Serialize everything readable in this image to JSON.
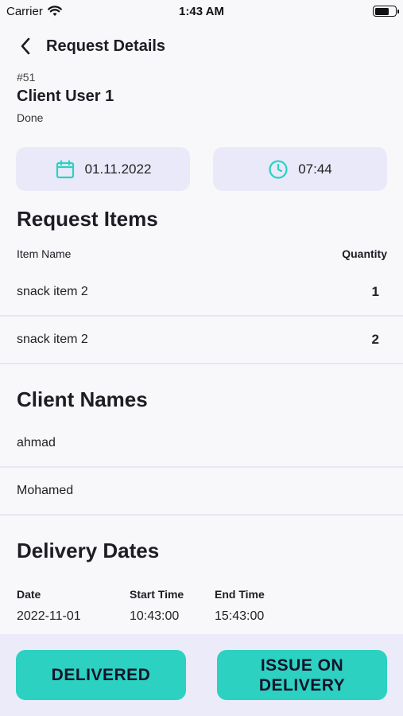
{
  "status_bar": {
    "carrier": "Carrier",
    "time": "1:43 AM"
  },
  "header": {
    "title": "Request Details"
  },
  "request": {
    "id": "#51",
    "client_user": "Client User 1",
    "status": "Done"
  },
  "date_pill": {
    "value": "01.11.2022",
    "icon": "calendar-icon"
  },
  "time_pill": {
    "value": "07:44",
    "icon": "clock-icon"
  },
  "items_section": {
    "title": "Request Items",
    "col_name": "Item Name",
    "col_qty": "Quantity",
    "rows": [
      {
        "name": "snack item 2",
        "qty": "1"
      },
      {
        "name": "snack item 2",
        "qty": "2"
      }
    ]
  },
  "clients_section": {
    "title": "Client Names",
    "names": [
      "ahmad",
      "Mohamed"
    ]
  },
  "delivery_section": {
    "title": "Delivery Dates",
    "col_date": "Date",
    "col_start": "Start Time",
    "col_end": "End Time",
    "rows": [
      {
        "date": "2022-11-01",
        "start": "10:43:00",
        "end": "15:43:00"
      }
    ]
  },
  "actions": {
    "delivered": "DELIVERED",
    "issue_line1": "ISSUE ON",
    "issue_line2": "DELIVERY"
  },
  "colors": {
    "accent": "#2cd1c1",
    "pill_bg": "#e9e9f9",
    "bottom_bar": "#ebebf9"
  }
}
